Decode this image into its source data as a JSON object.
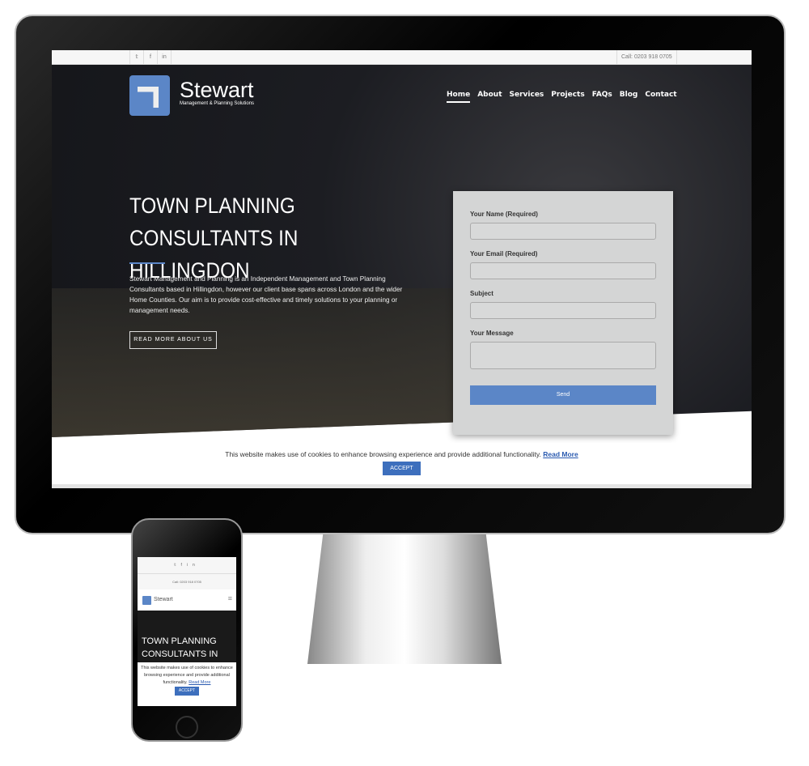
{
  "topbar": {
    "social": [
      "twitter-icon",
      "facebook-icon",
      "linkedin-icon"
    ],
    "social_glyphs": [
      "𝕥",
      "f",
      "in"
    ],
    "phone": "Call: 0203 918 0705"
  },
  "brand": {
    "name": "Stewart",
    "tagline": "Management & Planning Solutions"
  },
  "nav": [
    {
      "label": "Home",
      "active": true
    },
    {
      "label": "About"
    },
    {
      "label": "Services"
    },
    {
      "label": "Projects"
    },
    {
      "label": "FAQs"
    },
    {
      "label": "Blog"
    },
    {
      "label": "Contact"
    }
  ],
  "hero": {
    "title": "TOWN PLANNING CONSULTANTS IN HILLINGDON",
    "text": "Stewart Management and Planning is an Independent Management and Town Planning Consultants based in Hillingdon, however our client base spans across London and the wider Home Counties. Our aim is to provide cost-effective and timely solutions to your planning or management needs.",
    "button": "READ MORE ABOUT US"
  },
  "form": {
    "name_label": "Your Name (Required)",
    "email_label": "Your Email (Required)",
    "subject_label": "Subject",
    "message_label": "Your Message",
    "send": "Send"
  },
  "cookie": {
    "text": "This website makes use of cookies to enhance browsing experience and provide additional functionality.",
    "link": "Read More",
    "accept": "ACCEPT"
  },
  "mobile": {
    "phone": "Call: 0203 918 0705",
    "brand": "Stewart",
    "title": "TOWN PLANNING CONSULTANTS IN",
    "cookie_text": "This website makes use of cookies to enhance browsing experience and provide additional functionality.",
    "cookie_link": "Read More",
    "accept": "ACCEPT"
  },
  "colors": {
    "accent": "#5b86c7",
    "accept": "#3d6fbd"
  }
}
